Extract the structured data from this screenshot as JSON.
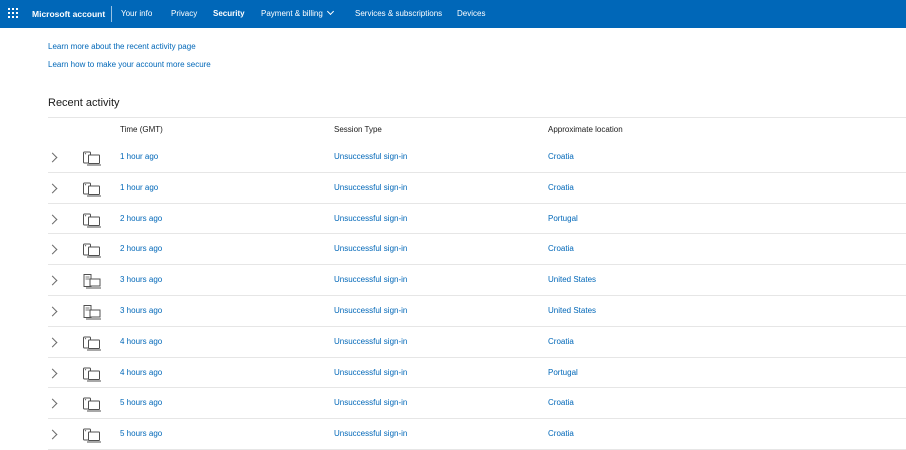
{
  "header": {
    "brand": "Microsoft account",
    "nav": [
      {
        "label": "Your info",
        "active": false
      },
      {
        "label": "Privacy",
        "active": false
      },
      {
        "label": "Security",
        "active": true
      },
      {
        "label": "Payment & billing",
        "active": false,
        "has_dropdown": true
      },
      {
        "label": "Services & subscriptions",
        "active": false
      },
      {
        "label": "Devices",
        "active": false
      }
    ],
    "bar_color": "#0067b8"
  },
  "links": {
    "learn_activity": "Learn more about the recent activity page",
    "learn_secure": "Learn how to make your account more secure"
  },
  "section": {
    "title": "Recent activity"
  },
  "table": {
    "columns": [
      "Time (GMT)",
      "Session Type",
      "Approximate location"
    ],
    "rows": [
      {
        "device": "mobile-device-icon",
        "time": "1 hour ago",
        "session": "Unsuccessful sign-in",
        "location": "Croatia"
      },
      {
        "device": "mobile-device-icon",
        "time": "1 hour ago",
        "session": "Unsuccessful sign-in",
        "location": "Croatia"
      },
      {
        "device": "mobile-device-icon",
        "time": "2 hours ago",
        "session": "Unsuccessful sign-in",
        "location": "Portugal"
      },
      {
        "device": "mobile-device-icon",
        "time": "2 hours ago",
        "session": "Unsuccessful sign-in",
        "location": "Croatia"
      },
      {
        "device": "desktop-device-icon",
        "time": "3 hours ago",
        "session": "Unsuccessful sign-in",
        "location": "United States"
      },
      {
        "device": "desktop-device-icon",
        "time": "3 hours ago",
        "session": "Unsuccessful sign-in",
        "location": "United States"
      },
      {
        "device": "mobile-device-icon",
        "time": "4 hours ago",
        "session": "Unsuccessful sign-in",
        "location": "Croatia"
      },
      {
        "device": "mobile-device-icon",
        "time": "4 hours ago",
        "session": "Unsuccessful sign-in",
        "location": "Portugal"
      },
      {
        "device": "mobile-device-icon",
        "time": "5 hours ago",
        "session": "Unsuccessful sign-in",
        "location": "Croatia"
      },
      {
        "device": "mobile-device-icon",
        "time": "5 hours ago",
        "session": "Unsuccessful sign-in",
        "location": "Croatia"
      }
    ]
  },
  "colors": {
    "accent": "#0067b8",
    "divider": "#e6e6e6",
    "text": "#1b1b1b"
  }
}
